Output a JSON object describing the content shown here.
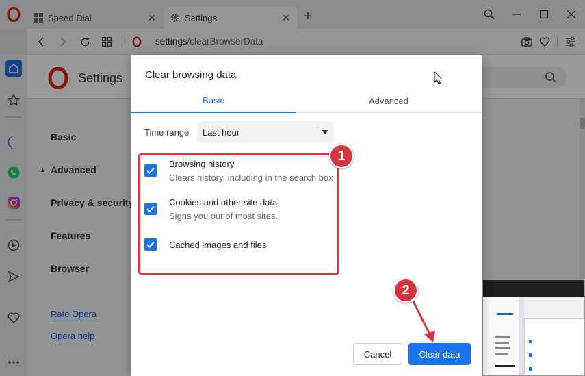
{
  "tabs": [
    {
      "title": "Speed Dial",
      "icon": "speed-dial-icon",
      "active": false
    },
    {
      "title": "Settings",
      "icon": "gear-icon",
      "active": true
    }
  ],
  "address": {
    "host": "settings",
    "path": "/clearBrowserData"
  },
  "settings_page": {
    "title": "Settings",
    "nav": {
      "basic": "Basic",
      "advanced": "Advanced",
      "privacy": "Privacy & security",
      "features": "Features",
      "browser": "Browser",
      "rate": "Rate Opera",
      "help": "Opera help"
    }
  },
  "dialog": {
    "title": "Clear browsing data",
    "tabs": {
      "basic": "Basic",
      "advanced": "Advanced"
    },
    "time_range_label": "Time range",
    "time_range_value": "Last hour",
    "options": [
      {
        "title": "Browsing history",
        "desc": "Clears history, including in the search box",
        "checked": true
      },
      {
        "title": "Cookies and other site data",
        "desc": "Signs you out of most sites.",
        "checked": true
      },
      {
        "title": "Cached images and files",
        "desc": "",
        "checked": true
      }
    ],
    "cancel_label": "Cancel",
    "clear_label": "Clear data"
  },
  "annotations": {
    "badge1": "1",
    "badge2": "2",
    "color": "#d6373f"
  },
  "colors": {
    "accent": "#1a73e8",
    "opera_red": "#e0201c"
  }
}
